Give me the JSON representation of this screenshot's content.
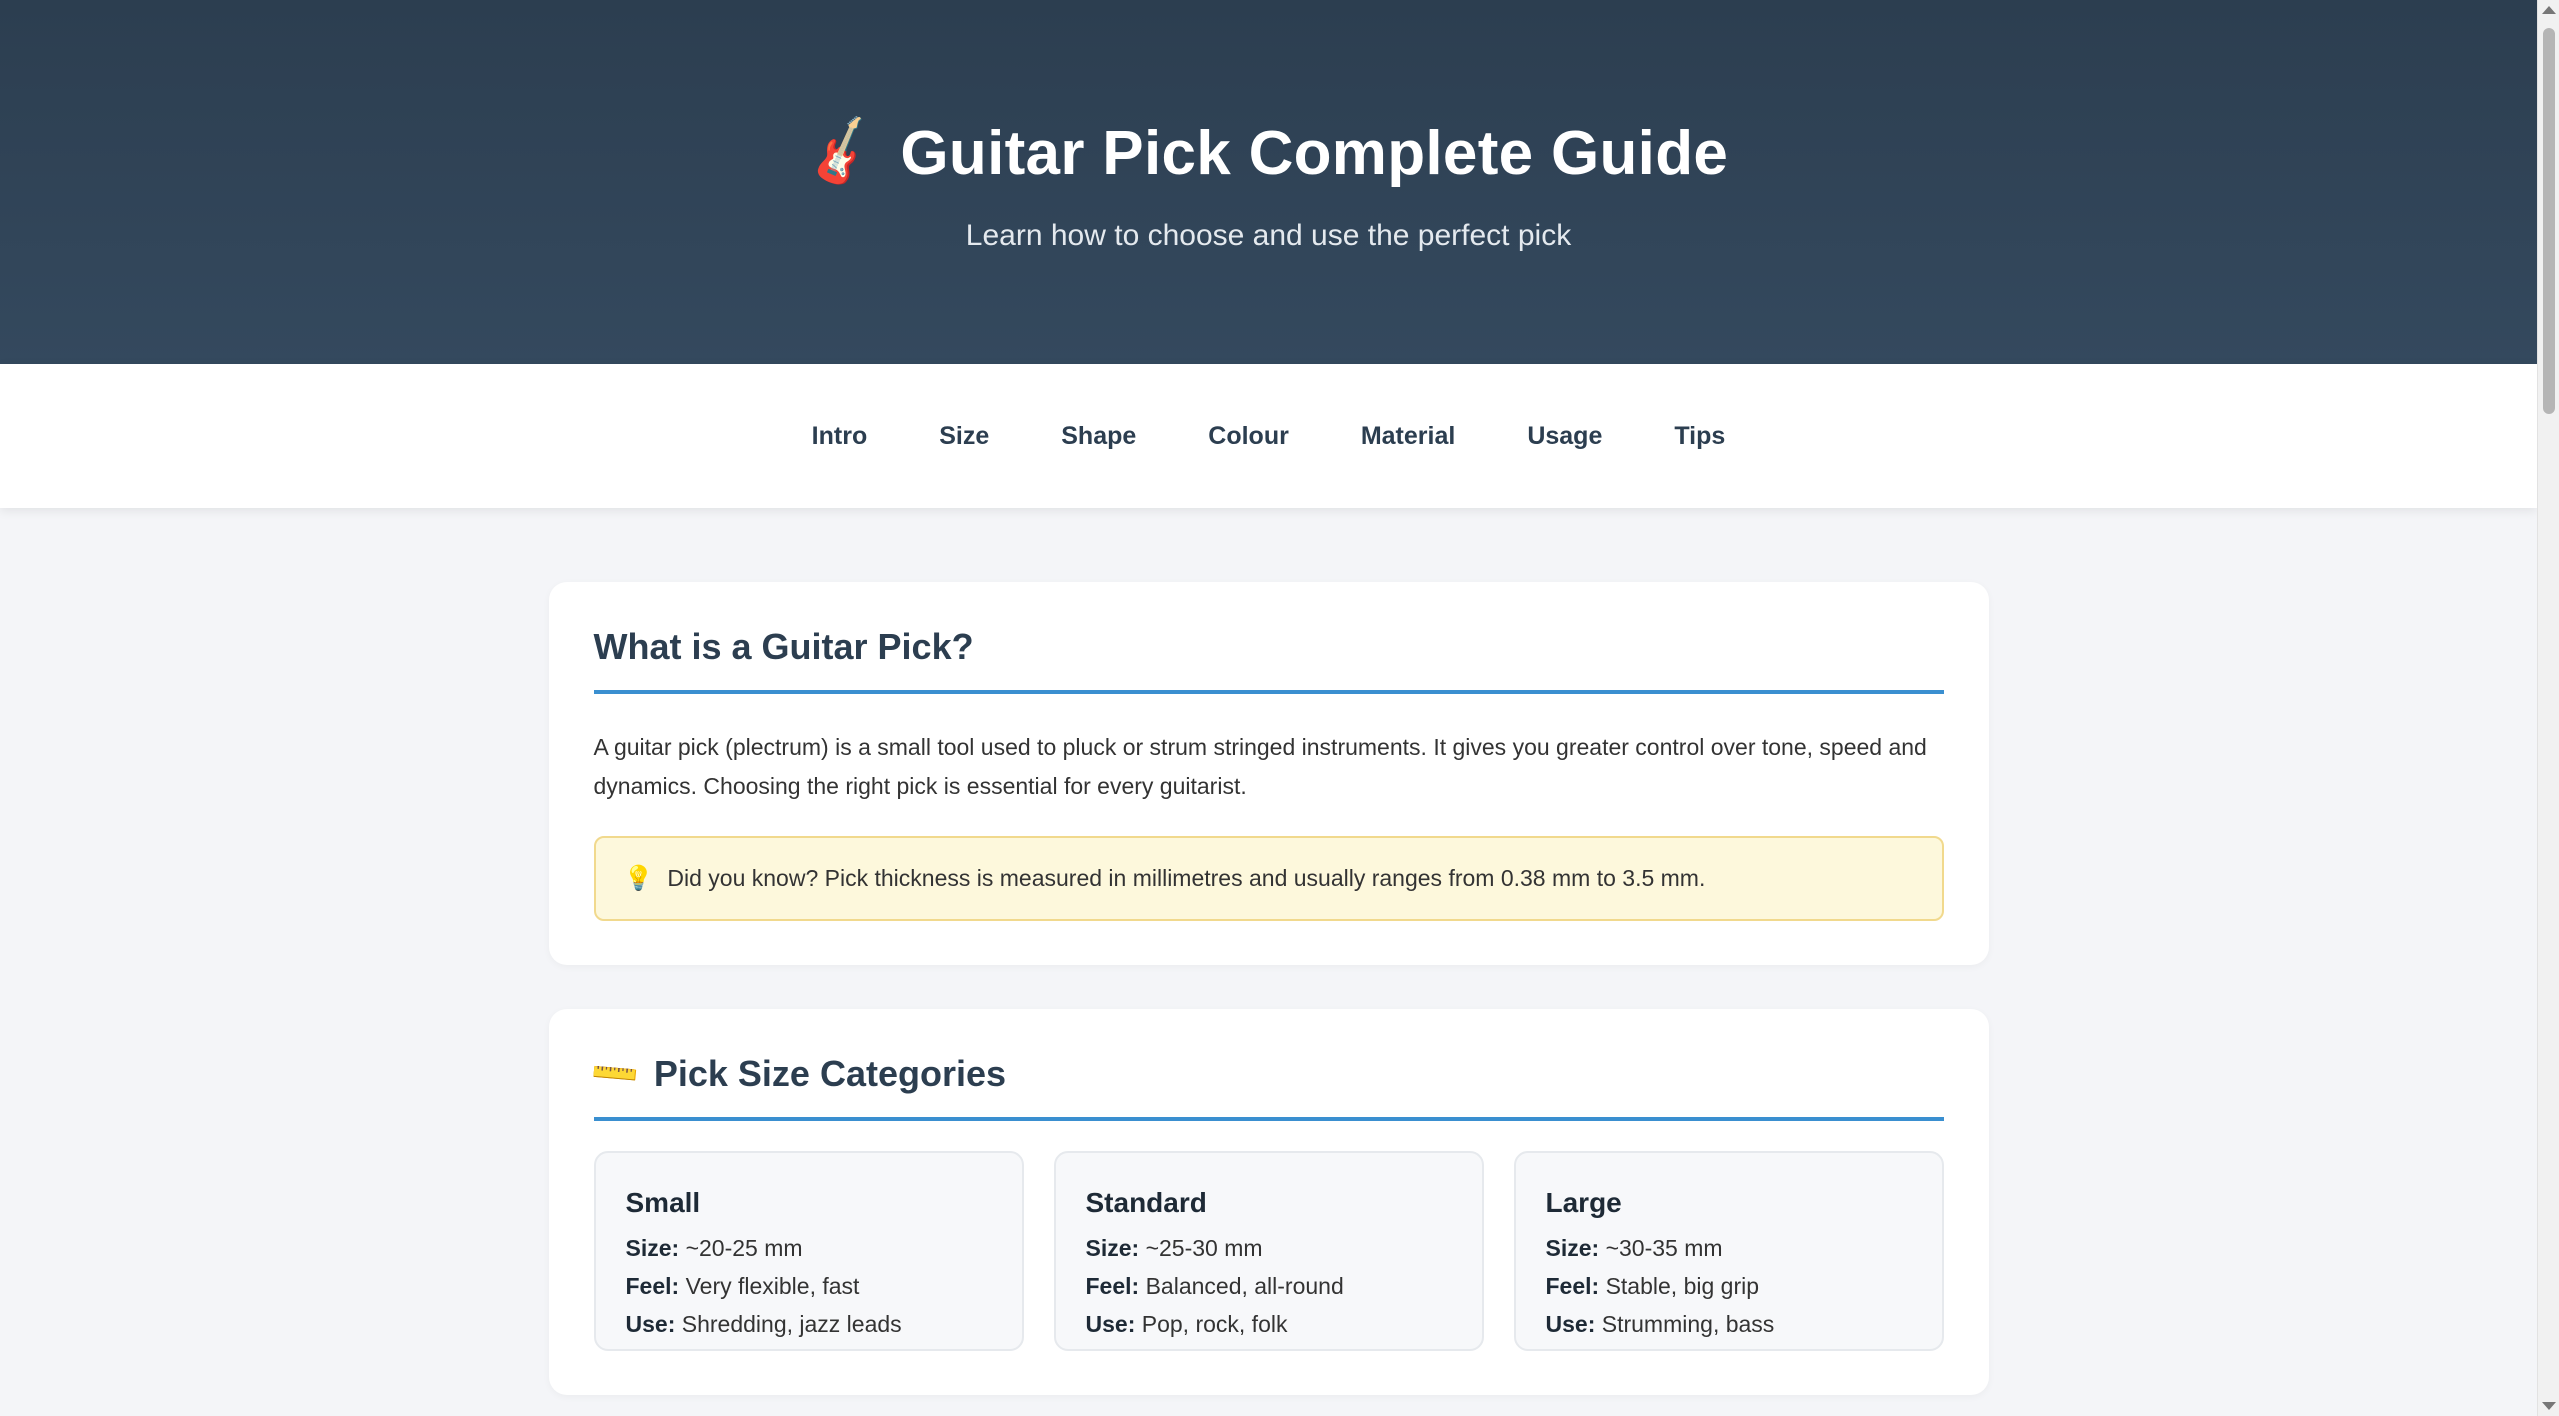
{
  "header": {
    "icon": "guitar-icon",
    "title": "Guitar Pick Complete Guide",
    "subtitle": "Learn how to choose and use the perfect pick"
  },
  "nav": {
    "items": [
      "Intro",
      "Size",
      "Shape",
      "Colour",
      "Material",
      "Usage",
      "Tips"
    ]
  },
  "intro": {
    "title": "What is a Guitar Pick?",
    "text": "A guitar pick (plectrum) is a small tool used to pluck or strum stringed instruments. It gives you greater control over tone, speed and dynamics. Choosing the right pick is essential for every guitarist.",
    "fact_icon": "lightbulb-icon",
    "fact": "Did you know? Pick thickness is measured in millimetres and usually ranges from 0.38 mm to 3.5 mm."
  },
  "sizes": {
    "icon": "ruler-icon",
    "title": "Pick Size Categories",
    "labels": {
      "size": "Size:",
      "feel": "Feel:",
      "use": "Use:"
    },
    "items": [
      {
        "name": "Small",
        "size": "~20-25 mm",
        "feel": "Very flexible, fast",
        "use": "Shredding, jazz leads"
      },
      {
        "name": "Standard",
        "size": "~25-30 mm",
        "feel": "Balanced, all-round",
        "use": "Pop, rock, folk"
      },
      {
        "name": "Large",
        "size": "~30-35 mm",
        "feel": "Stable, big grip",
        "use": "Strumming, bass"
      }
    ]
  },
  "colors": {
    "header_bg": "#2c3e50",
    "accent": "#3a8fd0",
    "fact_bg": "#fdf8dc"
  }
}
